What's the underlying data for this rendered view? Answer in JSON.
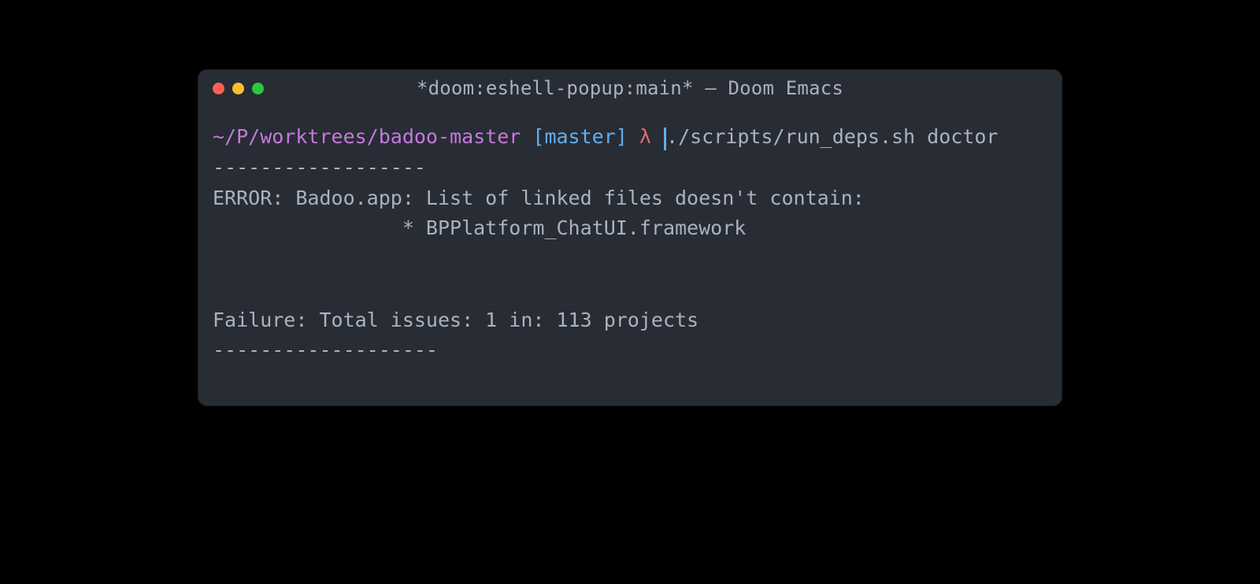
{
  "window": {
    "title": "*doom:eshell-popup:main* – Doom Emacs",
    "traffic_lights": {
      "close": "close",
      "minimize": "minimize",
      "maximize": "maximize"
    }
  },
  "prompt": {
    "path": "~/P/worktrees/badoo-master",
    "branch": "[master]",
    "symbol": "λ",
    "command": "./scripts/run_deps.sh doctor"
  },
  "output": {
    "sep1": "------------------",
    "error_line": "ERROR: Badoo.app: List of linked files doesn't contain:",
    "error_item": "                * BPPlatform_ChatUI.framework",
    "blank1": "",
    "blank2": "",
    "failure_line": "Failure: Total issues: 1 in: 113 projects",
    "sep2": "-------------------"
  },
  "colors": {
    "bg": "#000000",
    "window_bg": "#282c34",
    "text": "#abb2bf",
    "purple": "#c678dd",
    "blue": "#61afef",
    "red": "#e06c75",
    "traffic_red": "#ff5f56",
    "traffic_yellow": "#ffbd2e",
    "traffic_green": "#27c93f"
  }
}
